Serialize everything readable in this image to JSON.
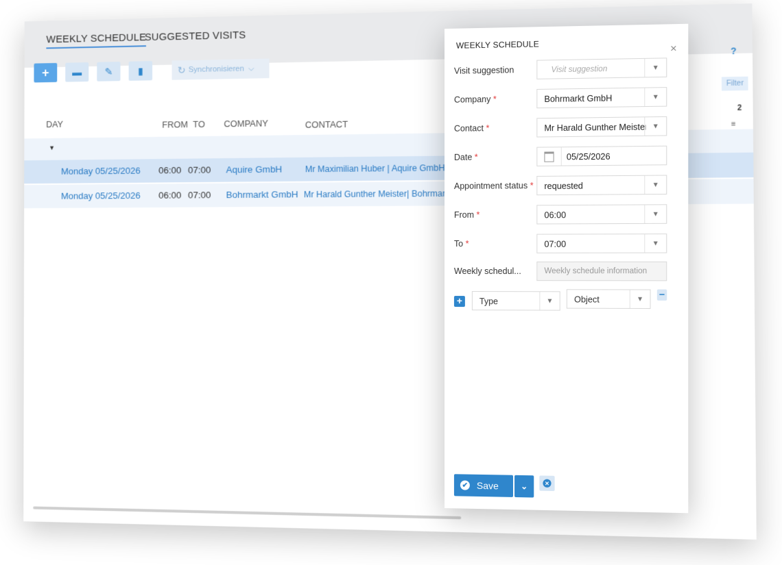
{
  "back_window": {
    "tabs": [
      "WEEKLY SCHEDULE",
      "SUGGESTED VISITS"
    ],
    "toolbar": {
      "sync_label": "Synchronisieren"
    },
    "columns": {
      "day": "DAY",
      "from": "FROM",
      "to": "TO",
      "company": "COMPANY",
      "contact": "CONTACT"
    },
    "rows": [
      {
        "day": "Monday 05/25/2026",
        "from": "06:00",
        "to": "07:00",
        "company": "Aquire GmbH",
        "contact": "Mr Maximilian Huber | Aquire GmbH"
      },
      {
        "day": "Monday 05/25/2026",
        "from": "06:00",
        "to": "07:00",
        "company": "Bohrmarkt GmbH",
        "contact": "Mr Harald Gunther Meister| Bohrmarkt"
      }
    ],
    "right_controls": {
      "help": "?",
      "filter": "Filter",
      "count": "2"
    }
  },
  "dialog": {
    "title": "WEEKLY SCHEDULE",
    "close": "×",
    "fields": {
      "visit_suggestion": {
        "label": "Visit suggestion",
        "placeholder": "Visit suggestion"
      },
      "company": {
        "label": "Company",
        "value": "Bohrmarkt GmbH"
      },
      "contact": {
        "label": "Contact",
        "value": "Mr Harald Gunther Meister"
      },
      "date": {
        "label": "Date",
        "value": "05/25/2026"
      },
      "appointment_status": {
        "label": "Appointment status",
        "value": "requested"
      },
      "from": {
        "label": "From",
        "value": "06:00"
      },
      "to": {
        "label": "To",
        "value": "07:00"
      },
      "weekly_info": {
        "label": "Weekly schedul...",
        "value": "Weekly schedule information"
      }
    },
    "type_row": {
      "type": "Type",
      "object": "Object"
    },
    "required_mark": "*",
    "save_label": "Save"
  }
}
